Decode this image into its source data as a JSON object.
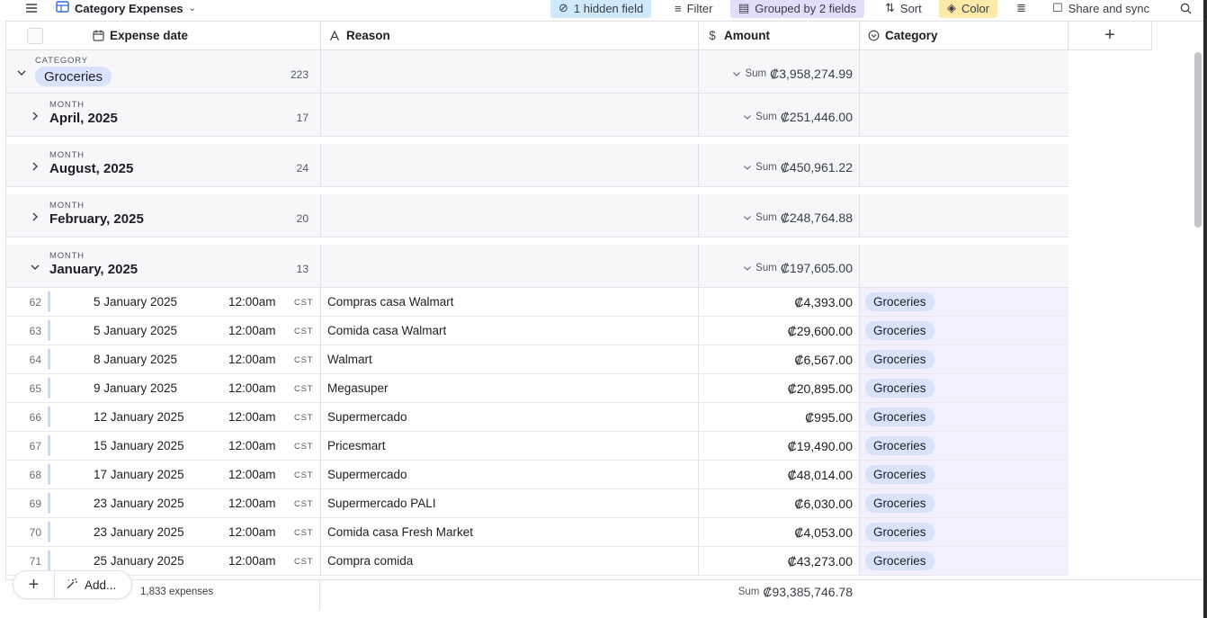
{
  "toolbar": {
    "title": "Category Expenses",
    "hidden_field": "1 hidden field",
    "filter": "Filter",
    "grouped": "Grouped by 2 fields",
    "sort": "Sort",
    "color": "Color",
    "share": "Share and sync"
  },
  "columns": {
    "expense_date": "Expense date",
    "reason": "Reason",
    "amount": "Amount",
    "category": "Category",
    "add": "+"
  },
  "group_top": {
    "label": "CATEGORY",
    "value": "Groceries",
    "count": "223",
    "sum_label": "Sum",
    "sum": "₡3,958,274.99"
  },
  "month_label": "MONTH",
  "sum_label": "Sum",
  "months": [
    {
      "name": "April, 2025",
      "count": "17",
      "sum": "₡251,446.00"
    },
    {
      "name": "August, 2025",
      "count": "24",
      "sum": "₡450,961.22"
    },
    {
      "name": "February, 2025",
      "count": "20",
      "sum": "₡248,764.88"
    },
    {
      "name": "January, 2025",
      "count": "13",
      "sum": "₡197,605.00"
    }
  ],
  "tz": "CST",
  "rows": [
    {
      "num": "62",
      "date": "5 January 2025",
      "time": "12:00am",
      "reason": "Compras casa Walmart",
      "amount": "₡4,393.00",
      "category": "Groceries"
    },
    {
      "num": "63",
      "date": "5 January 2025",
      "time": "12:00am",
      "reason": "Comida casa Walmart",
      "amount": "₡29,600.00",
      "category": "Groceries"
    },
    {
      "num": "64",
      "date": "8 January 2025",
      "time": "12:00am",
      "reason": "Walmart",
      "amount": "₡6,567.00",
      "category": "Groceries"
    },
    {
      "num": "65",
      "date": "9 January 2025",
      "time": "12:00am",
      "reason": "Megasuper",
      "amount": "₡20,895.00",
      "category": "Groceries"
    },
    {
      "num": "66",
      "date": "12 January 2025",
      "time": "12:00am",
      "reason": "Supermercado",
      "amount": "₡995.00",
      "category": "Groceries"
    },
    {
      "num": "67",
      "date": "15 January 2025",
      "time": "12:00am",
      "reason": "Pricesmart",
      "amount": "₡19,490.00",
      "category": "Groceries"
    },
    {
      "num": "68",
      "date": "17 January 2025",
      "time": "12:00am",
      "reason": "Supermercado",
      "amount": "₡48,014.00",
      "category": "Groceries"
    },
    {
      "num": "69",
      "date": "23 January 2025",
      "time": "12:00am",
      "reason": "Supermercado PALI",
      "amount": "₡6,030.00",
      "category": "Groceries"
    },
    {
      "num": "70",
      "date": "23 January 2025",
      "time": "12:00am",
      "reason": "Comida casa Fresh Market",
      "amount": "₡4,053.00",
      "category": "Groceries"
    },
    {
      "num": "71",
      "date": "25 January 2025",
      "time": "12:00am",
      "reason": "Compra comida",
      "amount": "₡43,273.00",
      "category": "Groceries"
    }
  ],
  "footer": {
    "add_label": "Add...",
    "count": "1,833 expenses",
    "sum_label": "Sum",
    "total": "₡93,385,746.78"
  }
}
